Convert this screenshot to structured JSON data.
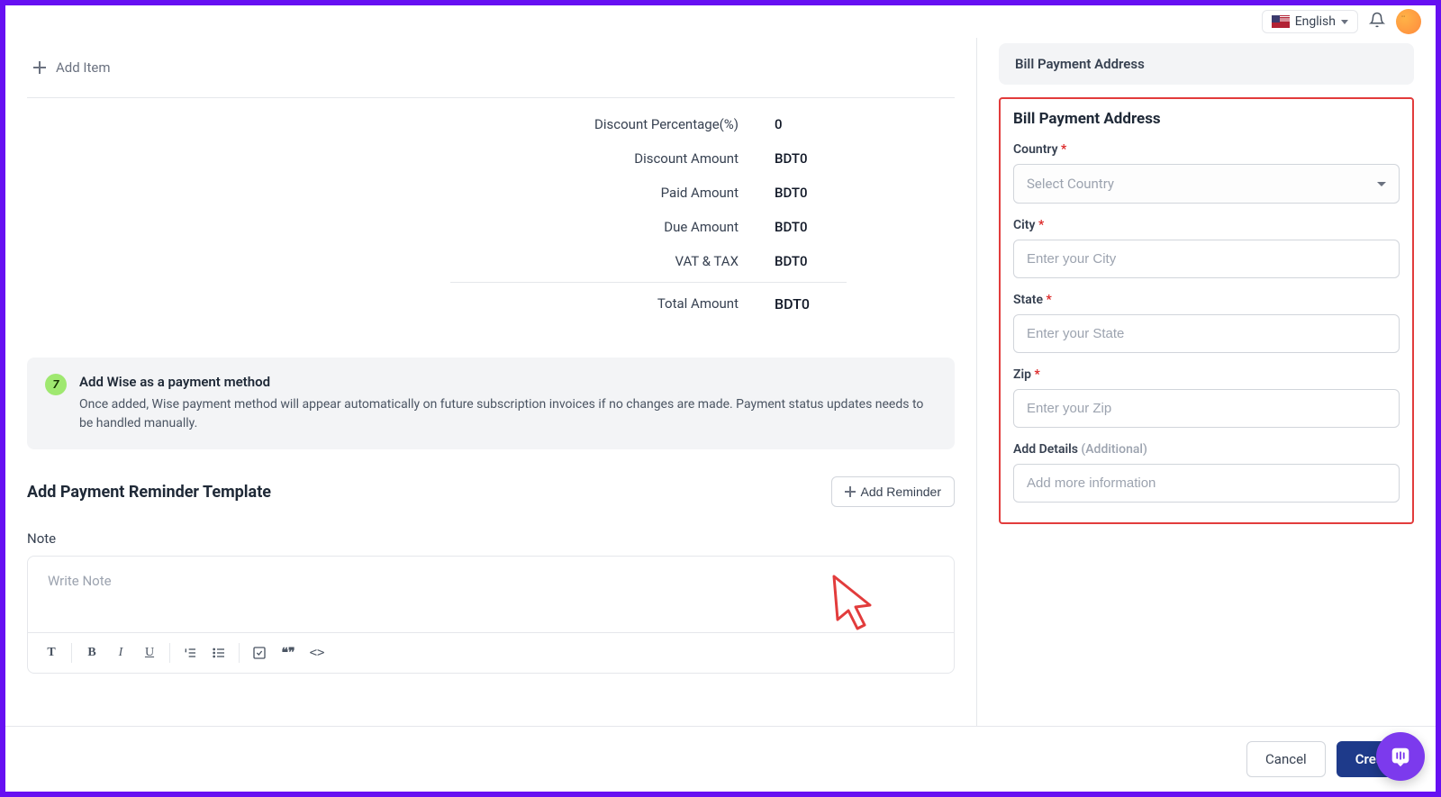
{
  "header": {
    "language": "English"
  },
  "left": {
    "add_item": "Add Item",
    "summary": {
      "discount_pct_label": "Discount Percentage(%)",
      "discount_pct_value": "0",
      "discount_amount_label": "Discount Amount",
      "discount_amount_value": "BDT0",
      "paid_label": "Paid Amount",
      "paid_value": "BDT0",
      "due_label": "Due Amount",
      "due_value": "BDT0",
      "vat_label": "VAT & TAX",
      "vat_value": "BDT0",
      "total_label": "Total Amount",
      "total_value": "BDT0"
    },
    "wise": {
      "icon_text": "7",
      "title": "Add Wise as a payment method",
      "desc": "Once added, Wise payment method will appear automatically on future subscription invoices if no changes are made. Payment status updates needs to be handled manually."
    },
    "reminder": {
      "heading": "Add Payment Reminder Template",
      "add_button": "Add Reminder"
    },
    "note": {
      "label": "Note",
      "placeholder": "Write Note"
    }
  },
  "right": {
    "panel_heading": "Bill Payment Address",
    "section_title": "Bill Payment Address",
    "fields": {
      "country_label": "Country",
      "country_placeholder": "Select Country",
      "city_label": "City",
      "city_placeholder": "Enter your City",
      "state_label": "State",
      "state_placeholder": "Enter your State",
      "zip_label": "Zip",
      "zip_placeholder": "Enter your Zip",
      "details_label": "Add Details ",
      "details_hint": "(Additional)",
      "details_placeholder": "Add more information"
    }
  },
  "footer": {
    "cancel": "Cancel",
    "create": "Create"
  }
}
